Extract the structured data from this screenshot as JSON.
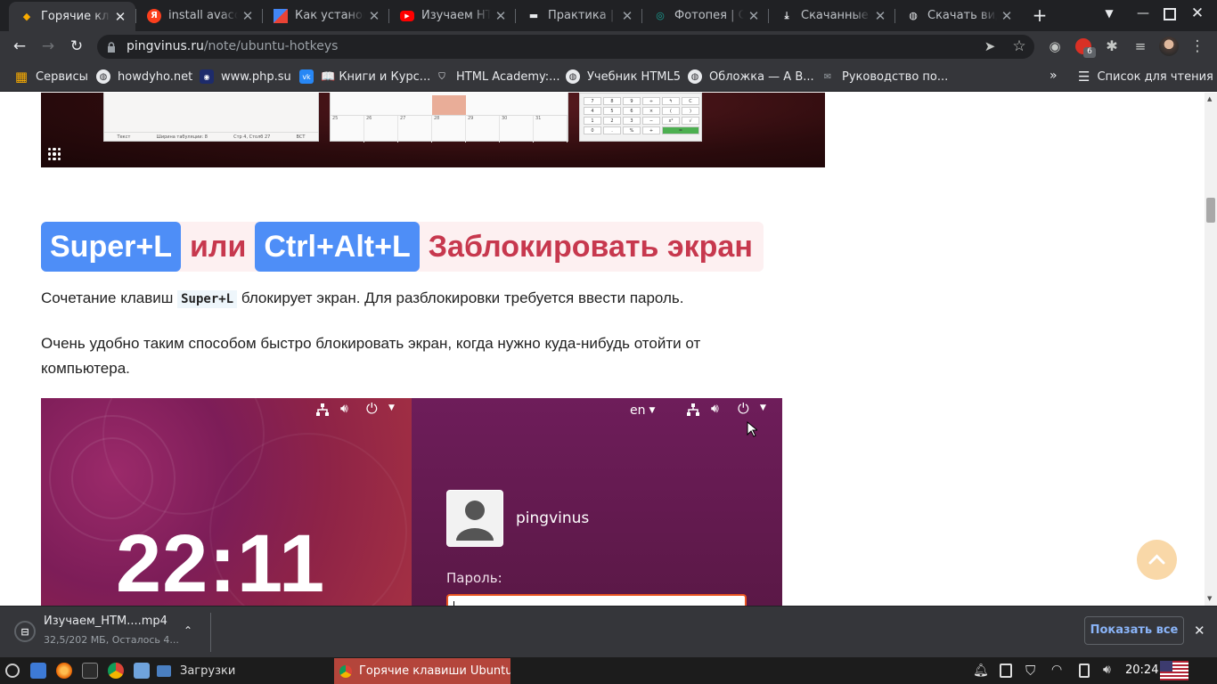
{
  "browser": {
    "tabs": [
      {
        "title": "Горячие клавиши Ubuntu",
        "icon": "bulb-icon",
        "color": "#f9ab00"
      },
      {
        "title": "install avacode",
        "icon": "yandex-icon",
        "color": "#fc3f1d"
      },
      {
        "title": "Как установить",
        "icon": "site-icon",
        "color": "#4285f4"
      },
      {
        "title": "Изучаем HTML",
        "icon": "youtube-icon",
        "color": "#ff0000"
      },
      {
        "title": "Практика | Web",
        "icon": "comment-icon",
        "color": "#e8eaed"
      },
      {
        "title": "Фотопея | Онлайн",
        "icon": "photopea-icon",
        "color": "#18a497"
      },
      {
        "title": "Скачанные файлы",
        "icon": "download-icon",
        "color": "#e8eaed"
      },
      {
        "title": "Скачать видео",
        "icon": "globe-icon",
        "color": "#e8eaed"
      }
    ],
    "url_domain": "pingvinus.ru",
    "url_path": "/note/ubuntu-hotkeys",
    "bookmarks": [
      {
        "label": "Сервисы",
        "icon": "apps-grid-icon"
      },
      {
        "label": "howdyho.net",
        "icon": "globe-icon"
      },
      {
        "label": "www.php.su",
        "icon": "php-icon"
      },
      {
        "label": "📖 Книги и Курс...",
        "icon": "vk-icon"
      },
      {
        "label": "HTML Academy:...",
        "icon": "shield-icon"
      },
      {
        "label": "Учебник HTML5",
        "icon": "globe-icon"
      },
      {
        "label": "Обложка — А В...",
        "icon": "globe-icon"
      },
      {
        "label": "Руководство по...",
        "icon": "mail-icon"
      }
    ],
    "reading_list": "Список для чтения",
    "extension_badge": "6"
  },
  "article": {
    "heading": {
      "key1": "Super+L",
      "or": "или",
      "key2": "Ctrl+Alt+L",
      "title": "Заблокировать экран"
    },
    "p1_before": "Сочетание клавиш ",
    "p1_code": "Super+L",
    "p1_after": " блокирует экран. Для разблокировки требуется ввести пароль.",
    "p2": "Очень удобно таким способом быстро блокировать экран, когда нужно куда-нибудь отойти от компьютера.",
    "top_screenshot": {
      "editor_status": [
        "Текст",
        "Ширина табуляции: 8",
        "Стр 4, Столб 27",
        "ВСТ"
      ],
      "calendar_days": [
        "25",
        "26",
        "27",
        "28",
        "29",
        "30",
        "31"
      ],
      "calc_keys": [
        "7",
        "8",
        "9",
        "÷",
        "↰",
        "C",
        "4",
        "5",
        "6",
        "×",
        "(",
        ")",
        "1",
        "2",
        "3",
        "−",
        "x²",
        "√",
        "0",
        ".",
        "%",
        "+",
        "="
      ]
    },
    "lock_screenshot": {
      "clock": "22:11",
      "lang": "en",
      "username": "pingvinus",
      "password_label": "Пароль:"
    }
  },
  "download": {
    "filename": "Изучаем_НТМ....mp4",
    "status": "32,5/202 МБ, Осталось 4...",
    "show_all": "Показать все"
  },
  "taskbar": {
    "folder_label": "Загрузки",
    "active_window": "Горячие клавиши Ubuntu...",
    "time": "20:24"
  }
}
